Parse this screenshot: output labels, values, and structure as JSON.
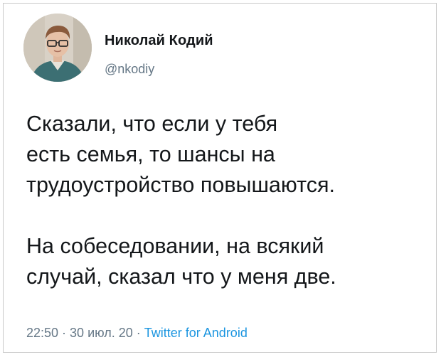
{
  "author": {
    "display_name": "Николай Кодий",
    "handle": "@nkodiy",
    "avatar_icon": "user-photo-avatar"
  },
  "tweet": {
    "paragraph1_lines": [
      "Сказали, что если у тебя",
      "есть семья, то шансы на",
      "трудоустройство повышаются."
    ],
    "paragraph2_lines": [
      "На собеседовании, на всякий",
      "случай, сказал что у меня две."
    ]
  },
  "meta": {
    "time": "22:50",
    "separator": " · ",
    "date": "30 июл. 20",
    "source": "Twitter for Android"
  },
  "colors": {
    "text": "#14171a",
    "secondary": "#657786",
    "link": "#1b95e0"
  }
}
